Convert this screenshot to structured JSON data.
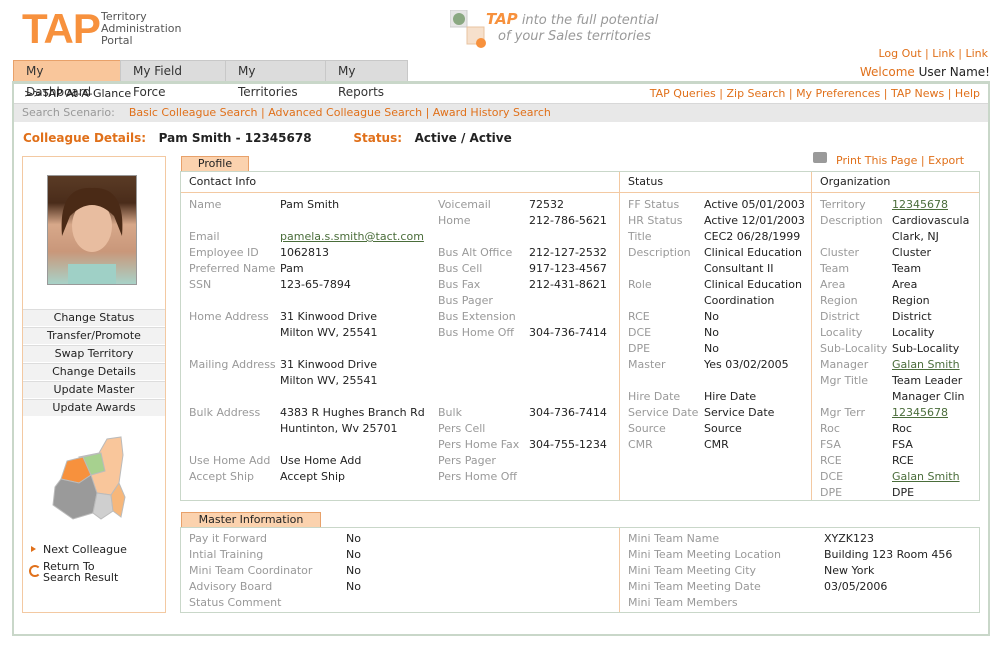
{
  "brand": {
    "logo": "TAP",
    "sub1": "Territory",
    "sub2": "Administration",
    "sub3": "Portal",
    "slogan_tap": "TAP",
    "slogan_1": "into the full potential",
    "slogan_2": "of your Sales territories"
  },
  "toplinks": [
    "Log Out",
    "Link",
    "Link"
  ],
  "welcome": {
    "label": "Welcome",
    "user": "User Name!"
  },
  "tabs": [
    "My Dashboard",
    "My Field Force",
    "My Territories",
    "My Reports"
  ],
  "crumb": ">>TAP At-A-Glance",
  "utility_links": [
    "TAP Queries",
    "Zip Search",
    "My Preferences",
    "TAP News",
    "Help"
  ],
  "search": {
    "label": "Search Scenario:",
    "links": [
      "Basic Colleague Search",
      "Advanced Colleague Search",
      "Award History Search"
    ]
  },
  "colleague": {
    "label": "Colleague Details:",
    "name": "Pam Smith - 12345678",
    "status_label": "Status:",
    "status": "Active / Active"
  },
  "actions": [
    "Change Status",
    "Transfer/Promote",
    "Swap Territory",
    "Change Details",
    "Update Master",
    "Update Awards"
  ],
  "nav": {
    "next": "Next Colleague",
    "return1": "Return To",
    "return2": "Search Result"
  },
  "profile": {
    "tab": "Profile",
    "print": "Print This Page",
    "export": "Export",
    "contact_head": "Contact Info",
    "status_head": "Status",
    "org_head": "Organization",
    "contact_left": [
      [
        "Name",
        "Pam Smith"
      ],
      [
        "",
        ""
      ],
      [
        "Email",
        "pamela.s.smith@tact.com"
      ],
      [
        "Employee ID",
        "1062813"
      ],
      [
        "Preferred Name",
        "Pam"
      ],
      [
        "SSN",
        "123-65-7894"
      ],
      [
        "",
        ""
      ],
      [
        "Home Address",
        "31 Kinwood Drive"
      ],
      [
        "",
        "Milton WV, 25541"
      ],
      [
        "",
        ""
      ],
      [
        "Mailing Address",
        "31 Kinwood Drive"
      ],
      [
        "",
        "Milton WV, 25541"
      ],
      [
        "",
        ""
      ],
      [
        "Bulk Address",
        "4383 R Hughes Branch Rd"
      ],
      [
        "",
        "Huntinton, Wv 25701"
      ],
      [
        "",
        ""
      ],
      [
        "Use Home Add",
        "Use Home Add"
      ],
      [
        "Accept Ship",
        "Accept Ship"
      ]
    ],
    "contact_right": [
      [
        "Voicemail",
        "72532"
      ],
      [
        "Home",
        "212-786-5621"
      ],
      [
        "",
        ""
      ],
      [
        "Bus Alt Office",
        "212-127-2532"
      ],
      [
        "Bus Cell",
        "917-123-4567"
      ],
      [
        "Bus Fax",
        "212-431-8621"
      ],
      [
        "Bus Pager",
        ""
      ],
      [
        "Bus Extension",
        ""
      ],
      [
        "Bus Home Off",
        "304-736-7414"
      ],
      [
        "",
        ""
      ],
      [
        "",
        ""
      ],
      [
        "",
        ""
      ],
      [
        "",
        ""
      ],
      [
        "Bulk",
        "304-736-7414"
      ],
      [
        "Pers Cell",
        ""
      ],
      [
        "Pers Home Fax",
        "304-755-1234"
      ],
      [
        "Pers Pager",
        ""
      ],
      [
        "Pers Home Off",
        ""
      ]
    ],
    "status": [
      [
        "FF Status",
        "Active 05/01/2003"
      ],
      [
        "HR Status",
        "Active 12/01/2003"
      ],
      [
        "Title",
        "CEC2 06/28/1999"
      ],
      [
        "Description",
        "Clinical Education"
      ],
      [
        "",
        "Consultant II"
      ],
      [
        "Role",
        "Clinical Education"
      ],
      [
        "",
        "Coordination"
      ],
      [
        "RCE",
        "No"
      ],
      [
        "DCE",
        "No"
      ],
      [
        "DPE",
        "No"
      ],
      [
        "Master",
        "Yes 03/02/2005"
      ],
      [
        "",
        ""
      ],
      [
        "Hire Date",
        "Hire Date"
      ],
      [
        "Service Date",
        "Service Date"
      ],
      [
        "Source",
        "Source"
      ],
      [
        "CMR",
        "CMR"
      ]
    ],
    "org": [
      [
        "Territory",
        "12345678"
      ],
      [
        "Description",
        "Cardiovascula"
      ],
      [
        "",
        "Clark, NJ"
      ],
      [
        "Cluster",
        "Cluster"
      ],
      [
        "Team",
        "Team"
      ],
      [
        "Area",
        "Area"
      ],
      [
        "Region",
        "Region"
      ],
      [
        "District",
        "District"
      ],
      [
        "Locality",
        "Locality"
      ],
      [
        "Sub-Locality",
        "Sub-Locality"
      ],
      [
        "Manager",
        "Galan Smith"
      ],
      [
        "Mgr Title",
        "Team Leader"
      ],
      [
        "",
        "Manager Clin"
      ],
      [
        "Mgr Terr",
        "12345678"
      ],
      [
        "Roc",
        "Roc"
      ],
      [
        "FSA",
        "FSA"
      ],
      [
        "RCE",
        "RCE"
      ],
      [
        "DCE",
        "Galan Smith"
      ],
      [
        "DPE",
        "DPE"
      ]
    ]
  },
  "master": {
    "tab": "Master Information",
    "left": [
      [
        "Pay it Forward",
        "No"
      ],
      [
        "Intial Training",
        "No"
      ],
      [
        "Mini Team Coordinator",
        "No"
      ],
      [
        "Advisory Board",
        "No"
      ],
      [
        "Status Comment",
        ""
      ]
    ],
    "right": [
      [
        "Mini Team Name",
        "XYZK123"
      ],
      [
        "Mini Team Meeting Location",
        "Building 123 Room 456"
      ],
      [
        "Mini Team Meeting City",
        "New York"
      ],
      [
        "Mini Team Meeting Date",
        "03/05/2006"
      ],
      [
        "Mini Team Members",
        ""
      ]
    ]
  }
}
